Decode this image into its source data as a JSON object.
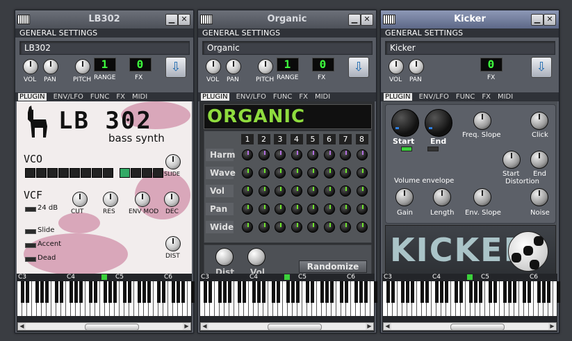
{
  "windows": [
    {
      "title": "LB302",
      "minimize_glyph": "▁",
      "close_glyph": "✕",
      "general_settings": "GENERAL SETTINGS",
      "name": "LB302",
      "vol_label": "VOL",
      "pan_label": "PAN",
      "pitch_label": "PITCH",
      "range_label": "RANGE",
      "range_value": "1",
      "fx_label": "FX",
      "fx_value": "0",
      "tabs": [
        "PLUGIN",
        "ENV/LFO",
        "FUNC",
        "FX",
        "MIDI"
      ],
      "octaves": [
        "C3",
        "C4",
        "C5",
        "C6"
      ]
    },
    {
      "title": "Organic",
      "minimize_glyph": "▁",
      "close_glyph": "✕",
      "general_settings": "GENERAL SETTINGS",
      "name": "Organic",
      "vol_label": "VOL",
      "pan_label": "PAN",
      "pitch_label": "PITCH",
      "range_label": "RANGE",
      "range_value": "1",
      "fx_label": "FX",
      "fx_value": "0",
      "tabs": [
        "PLUGIN",
        "ENV/LFO",
        "FUNC",
        "FX",
        "MIDI"
      ],
      "octaves": [
        "C3",
        "C4",
        "C5",
        "C6"
      ]
    },
    {
      "title": "Kicker",
      "minimize_glyph": "▁",
      "close_glyph": "✕",
      "general_settings": "GENERAL SETTINGS",
      "name": "Kicker",
      "vol_label": "VOL",
      "pan_label": "PAN",
      "fx_label": "FX",
      "fx_value": "0",
      "tabs": [
        "PLUGIN",
        "ENV/LFO",
        "FUNC",
        "FX",
        "MIDI"
      ],
      "octaves": [
        "C3",
        "C4",
        "C5",
        "C6"
      ]
    }
  ],
  "lb302": {
    "logo_title": "LB 302",
    "logo_subtitle": "bass synth",
    "vco_label": "VCO",
    "slide_label": "SLIDE",
    "vcf_label": "VCF",
    "db24_label": "24 dB",
    "cut_label": "CUT",
    "res_label": "RES",
    "envmod_label": "ENV MOD",
    "dec_label": "DEC",
    "slide_toggle": "Slide",
    "accent_toggle": "Accent",
    "dead_toggle": "Dead",
    "dist_label": "DIST"
  },
  "organic": {
    "logo_text": "ORGANIC",
    "columns": [
      "1",
      "2",
      "3",
      "4",
      "5",
      "6",
      "7",
      "8"
    ],
    "rows": [
      "Harm",
      "Wave",
      "Vol",
      "Pan",
      "Wide"
    ],
    "dist_label": "Dist",
    "vol_label": "Vol",
    "randomize_label": "Randomize"
  },
  "kicker": {
    "start_label": "Start",
    "end_label": "End",
    "freq_slope_label": "Freq. Slope",
    "click_label": "Click",
    "start_dist_label": "Start",
    "end_dist_label": "End",
    "distortion_label": "Distortion",
    "volume_envelope_label": "Volume envelope",
    "gain_label": "Gain",
    "length_label": "Length",
    "env_slope_label": "Env. Slope",
    "noise_label": "Noise",
    "logo_text": "KICKER"
  },
  "colors": {
    "lcd_green": "#3dfd3d",
    "organic_green": "#8fdc3e",
    "active_title": "#7e8aac",
    "lb302_splash": "#c46d8f"
  },
  "icons": [
    "piano-icon",
    "minimize-icon",
    "close-icon",
    "download-preset-icon",
    "llama-icon",
    "soccer-ball-icon"
  ]
}
